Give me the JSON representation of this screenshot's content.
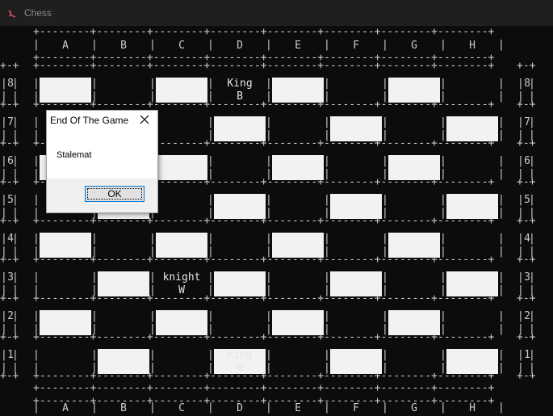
{
  "window": {
    "title": "Chess"
  },
  "board": {
    "columns": [
      "A",
      "B",
      "C",
      "D",
      "E",
      "F",
      "G",
      "H"
    ],
    "rows": [
      "8",
      "7",
      "6",
      "5",
      "4",
      "3",
      "2",
      "1"
    ],
    "pieces": [
      {
        "square": "D8",
        "name": "King",
        "color": "B"
      },
      {
        "square": "C3",
        "name": "knight",
        "color": "W"
      },
      {
        "square": "D1",
        "name": "King",
        "color": "W"
      }
    ],
    "light_square_color": "#f2f2f2",
    "background_color": "#0c0c0c"
  },
  "dialog": {
    "title": "End Of The Game",
    "message": "Stalemat",
    "ok_label": "OK"
  }
}
